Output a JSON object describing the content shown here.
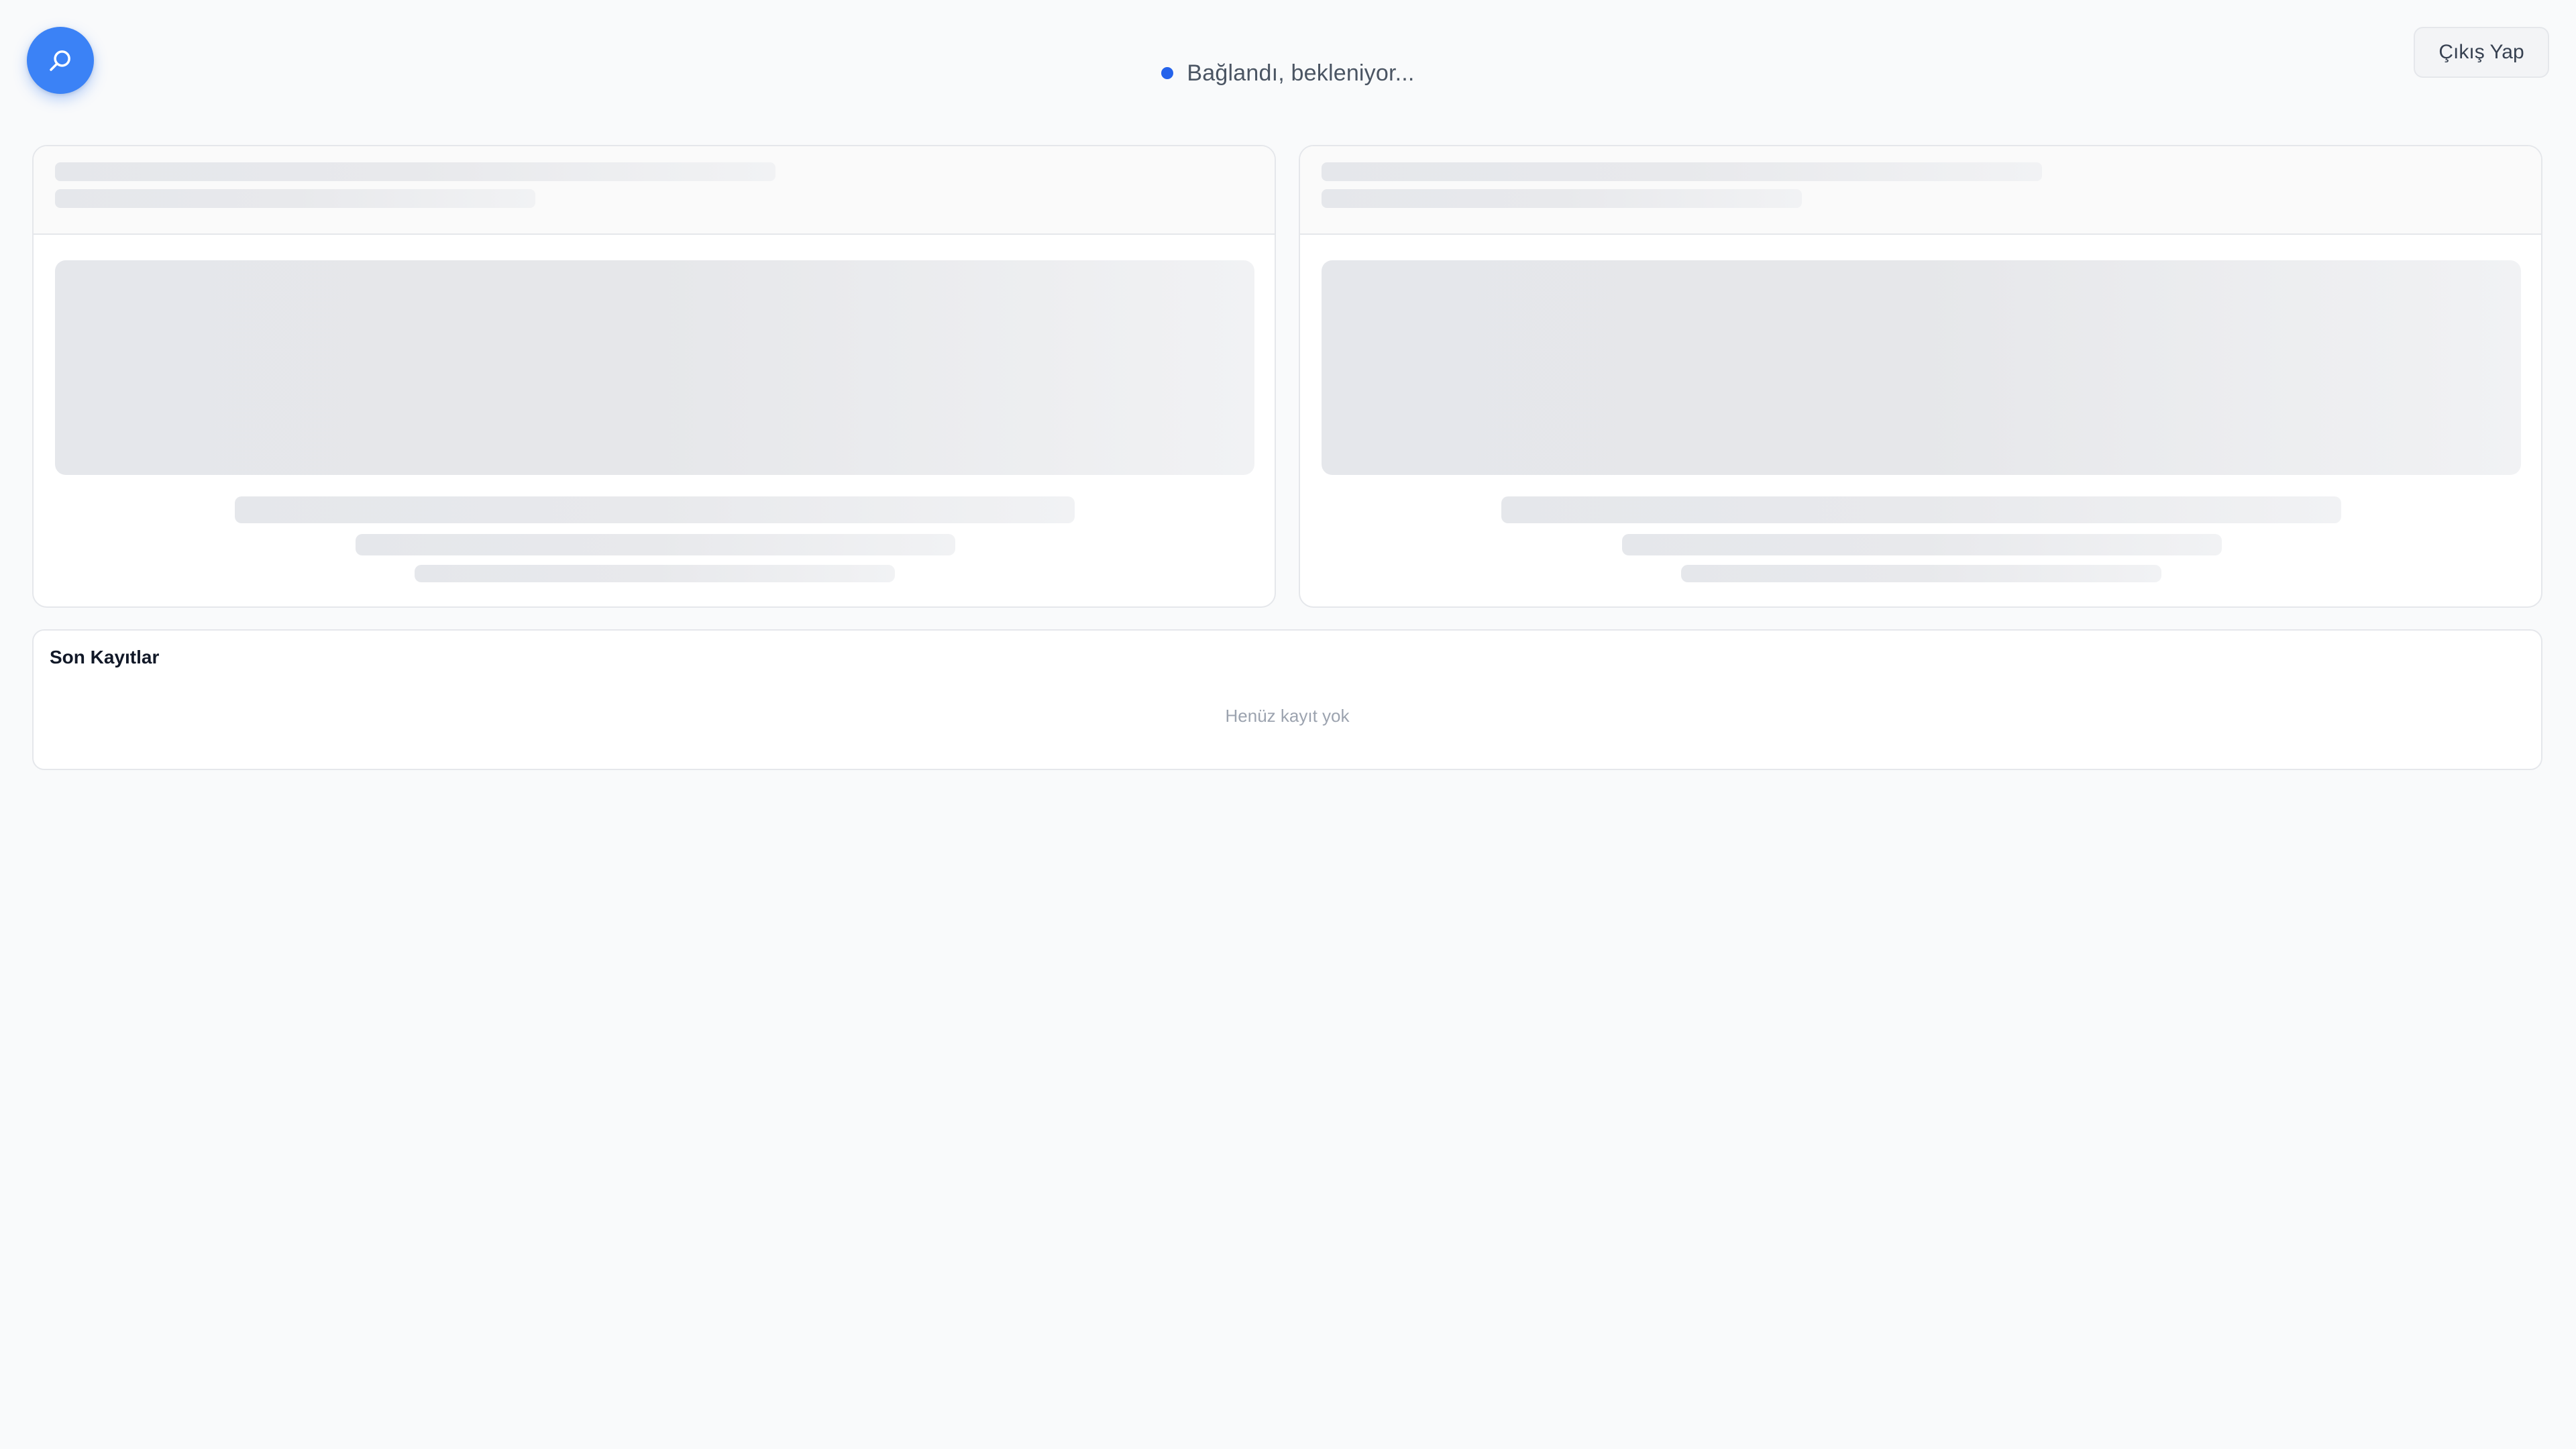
{
  "header": {
    "search_fab_icon": "search-icon",
    "status": {
      "text": "Bağlandı, bekleniyor...",
      "dot_color": "#2563eb"
    },
    "logout_label": "Çıkış Yap"
  },
  "theme": {
    "accent": "#3b82f6",
    "background": "#f9fafb"
  },
  "panels": [
    {
      "state": "loading"
    },
    {
      "state": "loading"
    }
  ],
  "records": {
    "title": "Son Kayıtlar",
    "empty_text": "Henüz kayıt yok"
  }
}
